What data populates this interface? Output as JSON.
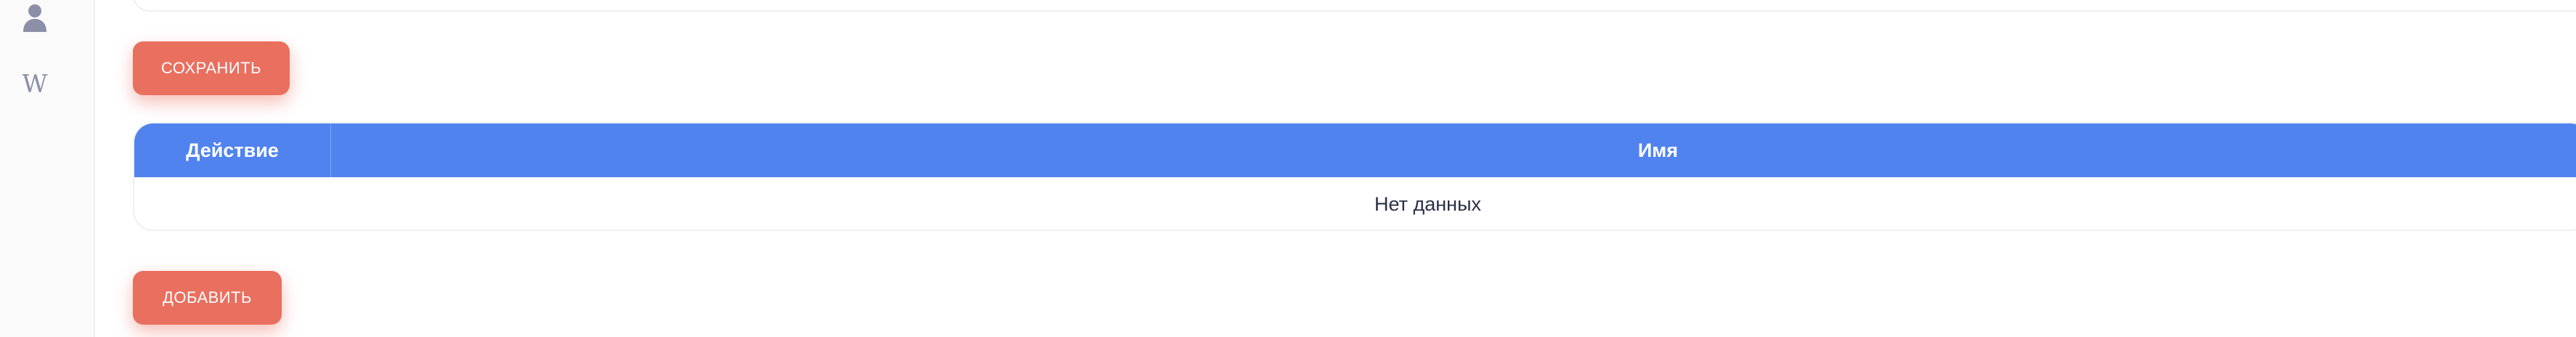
{
  "sidebar": {
    "icons": [
      {
        "name": "user-icon"
      },
      {
        "name": "wiki-icon",
        "glyph": "W"
      }
    ]
  },
  "buttons": {
    "save_label": "СОХРАНИТЬ",
    "add_label": "ДОБАВИТЬ"
  },
  "table": {
    "columns": [
      "Действие",
      "Имя"
    ],
    "empty_text": "Нет данных"
  },
  "colors": {
    "accent_button": "#e96f5f",
    "table_header": "#5183ef",
    "icon_gray": "#8b90a6"
  }
}
